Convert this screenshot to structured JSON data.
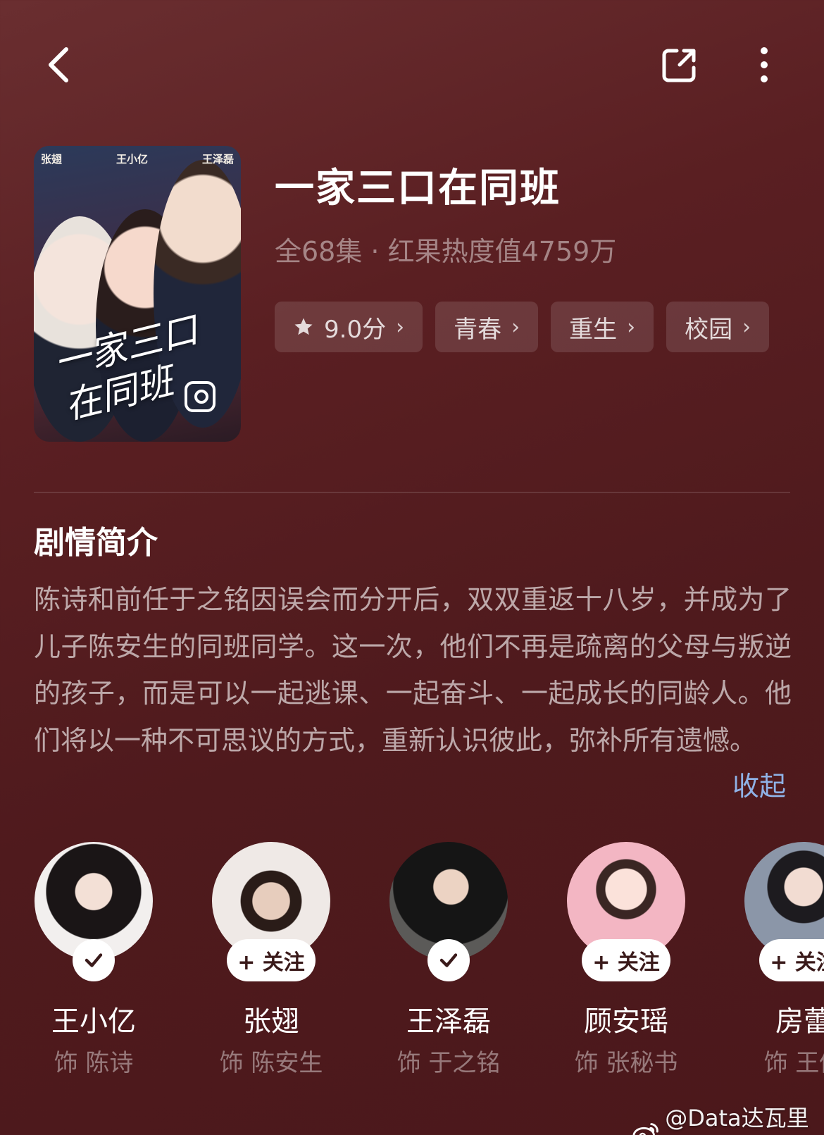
{
  "header": {
    "back_icon": "chevron-left-icon",
    "share_icon": "share-icon",
    "more_icon": "more-vertical-icon"
  },
  "poster": {
    "cast_top": [
      "张翅",
      "王小亿",
      "王泽磊"
    ],
    "calligraphy_title": "一家三口在同班"
  },
  "drama": {
    "title": "一家三口在同班",
    "meta": "全68集 · 红果热度值4759万",
    "tags": [
      {
        "label": "9.0分",
        "icon": "star-icon"
      },
      {
        "label": "青春"
      },
      {
        "label": "重生"
      },
      {
        "label": "校园"
      }
    ]
  },
  "synopsis": {
    "heading": "剧情简介",
    "text": "陈诗和前任于之铭因误会而分开后，双双重返十八岁，并成为了儿子陈安生的同班同学。这一次，他们不再是疏离的父母与叛逆的孩子，而是可以一起逃课、一起奋斗、一起成长的同龄人。他们将以一种不可思议的方式，重新认识彼此，弥补所有遗憾。",
    "collapse_label": "收起"
  },
  "cast": [
    {
      "name": "王小亿",
      "role": "饰 陈诗",
      "followed": true,
      "follow_label": ""
    },
    {
      "name": "张翅",
      "role": "饰 陈安生",
      "followed": false,
      "follow_label": "+ 关注"
    },
    {
      "name": "王泽磊",
      "role": "饰 于之铭",
      "followed": true,
      "follow_label": ""
    },
    {
      "name": "顾安瑶",
      "role": "饰 张秘书",
      "followed": false,
      "follow_label": "+ 关注"
    },
    {
      "name": "房蕾",
      "role": "饰 王倩",
      "followed": false,
      "follow_label": "+ 关注"
    }
  ],
  "watermark": {
    "text": "@Data达瓦里氏",
    "icon": "weibo-icon"
  },
  "colors": {
    "background": "#4f1a1d",
    "link": "#8fb2e6"
  }
}
